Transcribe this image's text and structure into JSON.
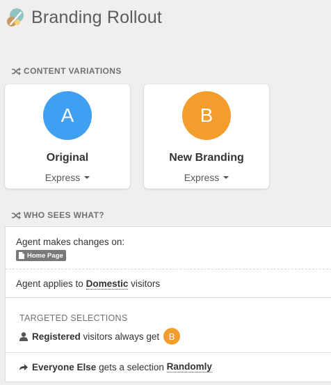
{
  "header": {
    "title": "Branding Rollout",
    "logo_icon": "experiment-logo-icon"
  },
  "sections": {
    "content_variations": "CONTENT VARIATIONS",
    "who_sees_what": "WHO SEES WHAT?"
  },
  "variations": [
    {
      "letter": "A",
      "name": "Original",
      "select_value": "Express",
      "color": "#3f9ff0"
    },
    {
      "letter": "B",
      "name": "New Branding",
      "select_value": "Express",
      "color": "#f29d2d"
    }
  ],
  "who": {
    "agent_changes_label": "Agent makes changes on:",
    "page_tag": "Home Page",
    "applies_prefix": "Agent applies to",
    "applies_audience": "Domestic",
    "applies_suffix": "visitors",
    "targeted_heading": "TARGETED SELECTIONS",
    "registered_bold": "Registered",
    "registered_text": "visitors always get",
    "registered_variation": "B",
    "everyone_bold": "Everyone Else",
    "everyone_text": "gets a selection",
    "everyone_mode": "Randomly"
  },
  "colors": {
    "background": "#f1efed",
    "variation_a": "#3f9ff0",
    "variation_b": "#f29d2d",
    "tag_bg": "#787878"
  }
}
